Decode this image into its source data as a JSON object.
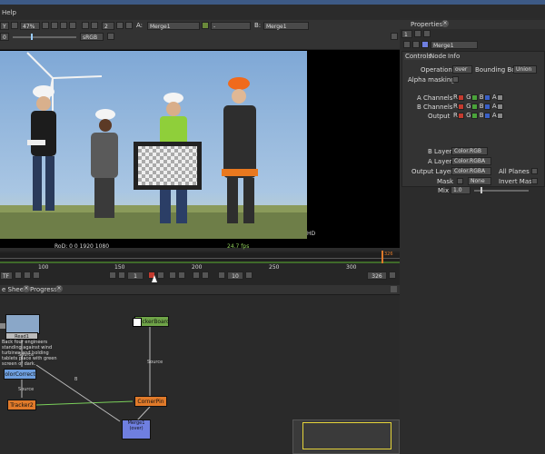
{
  "menu": {
    "help": "Help"
  },
  "toolbar": {
    "layer_combo": "Y",
    "zoom": "47%",
    "frame_val": "0",
    "gain_val": "1",
    "gamma_val": "2",
    "colorspace": "sRGB",
    "input_a_label": "A:",
    "input_a_value": "Merge1",
    "input_b_label": "B:",
    "input_b_value": "Merge1",
    "op_value": "-"
  },
  "viewer": {
    "format_label": "HD",
    "roi_text": "RoD: 0 0 1920 1080",
    "fps_text": "24.7 fps"
  },
  "timeline": {
    "ruler_labels": [
      "100",
      "150",
      "200",
      "250",
      "300"
    ],
    "end_marker": "326",
    "current_frame": "1",
    "step_value": "10",
    "last_frame": "326",
    "fps_combo": "TF"
  },
  "nodegraph": {
    "tabs": [
      "e Sheet",
      "Progress"
    ],
    "nodes": {
      "read": "Read1",
      "read_caption": "Back four engineers standing against wind turbines and holding tablets place with green screen of dark, embossed_Scale...",
      "checker": "heckerBoard",
      "color_correct": "olorCorrect",
      "tracker": "Tracker2",
      "corner_pin": "CornerPin",
      "merge": "Merge1",
      "merge_sub": "(over)"
    },
    "edges": {
      "source1": "Source",
      "source2": "Source",
      "source3": "Source",
      "b": "B"
    }
  },
  "properties": {
    "header": "Properties",
    "pin_count": "1",
    "node_name": "Merge1",
    "tabs": [
      "Controls",
      "Node",
      "Info"
    ],
    "operation_label": "Operation",
    "operation_value": "over",
    "bbox_label": "Bounding Box",
    "bbox_value": "Union",
    "alpha_masking_label": "Alpha masking",
    "a_channels_label": "A Channels",
    "b_channels_label": "B Channels",
    "output_label": "Output",
    "channel_letters": [
      "R",
      "G",
      "B",
      "A"
    ],
    "b_layer_label": "B Layer",
    "b_layer_value": "Color.RGB",
    "a_layer_label": "A Layer",
    "a_layer_value": "Color.RGBA",
    "output_layer_label": "Output Layer",
    "output_layer_value": "Color.RGBA",
    "all_planes_label": "All Planes",
    "mask_label": "Mask",
    "mask_value": "None",
    "invert_mask_label": "Invert Mask",
    "mix_label": "Mix",
    "mix_value": "1.0"
  }
}
